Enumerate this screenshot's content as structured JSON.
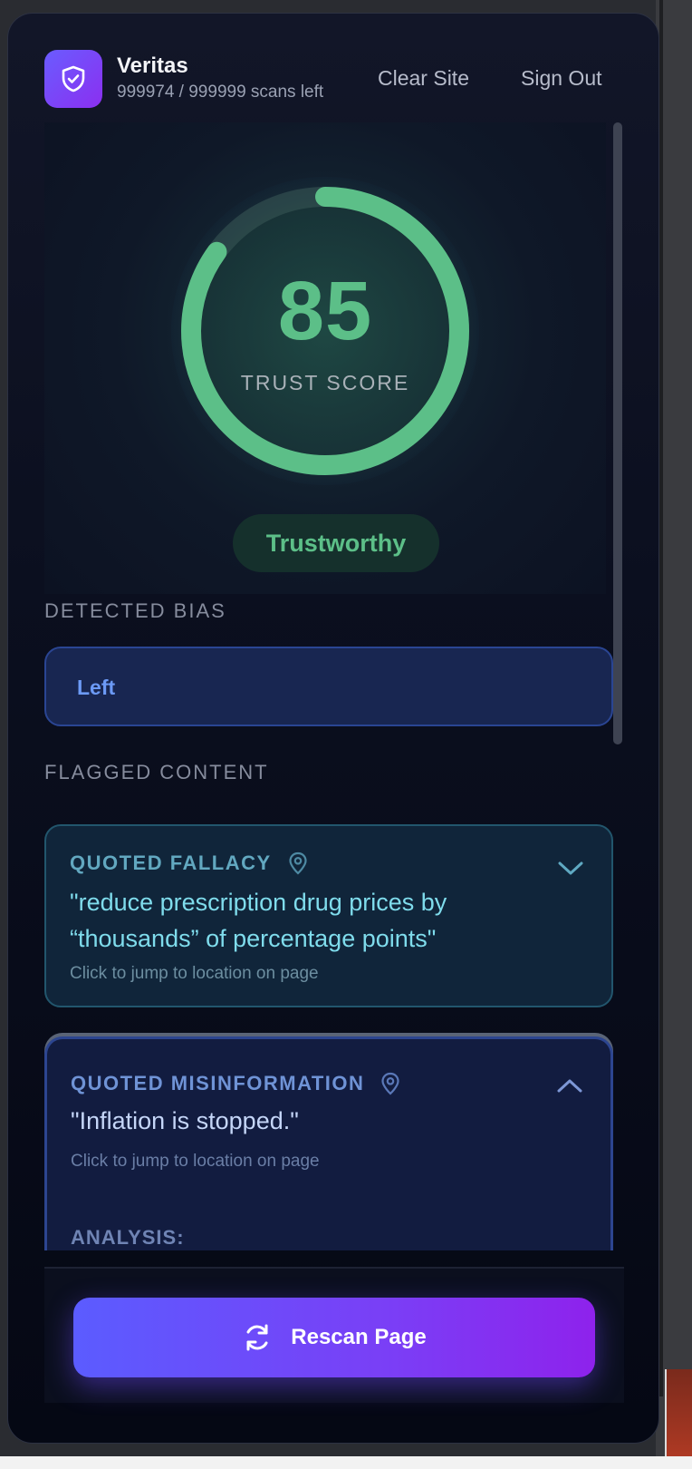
{
  "header": {
    "app_name": "Veritas",
    "scans_left": "999974 / 999999 scans left",
    "clear_site_label": "Clear Site",
    "sign_out_label": "Sign Out",
    "logo_icon": "shield-check-icon"
  },
  "score": {
    "value": "85",
    "progress": 0.85,
    "label": "TRUST SCORE",
    "verdict": "Trustworthy",
    "accent_color": "#5cbf88"
  },
  "bias": {
    "section_label": "DETECTED BIAS",
    "value": "Left"
  },
  "flagged": {
    "section_label": "FLAGGED CONTENT",
    "items": [
      {
        "type": "QUOTED FALLACY",
        "quote_line1": "\"reduce prescription drug prices by",
        "quote_line2": "“thousands” of percentage points\"",
        "jump_hint": "Click to jump to location on page",
        "expanded": false
      },
      {
        "type": "QUOTED MISINFORMATION",
        "quote_line1": "\"Inflation is stopped.\"",
        "jump_hint": "Click to jump to location on page",
        "analysis_label": "ANALYSIS:",
        "expanded": true
      }
    ]
  },
  "footer": {
    "rescan_label": "Rescan Page",
    "rescan_icon": "refresh-icon"
  }
}
